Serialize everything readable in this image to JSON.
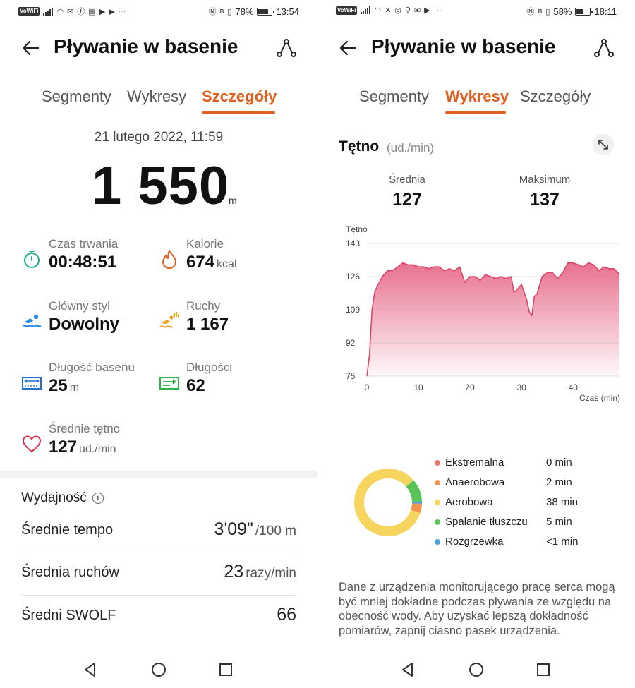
{
  "left": {
    "status": {
      "carrier": "VoWiFi",
      "battery": "78%",
      "battery_level": 0.78,
      "time": "13:54",
      "notif_icons": [
        "signal-icon",
        "wifi-icon",
        "mail-icon",
        "facebook-icon",
        "app-icon",
        "youtube-icon",
        "youtube-icon",
        "more-icon"
      ]
    },
    "header": {
      "title": "Pływanie w basenie"
    },
    "tabs": [
      {
        "label": "Segmenty"
      },
      {
        "label": "Wykresy"
      },
      {
        "label": "Szczegóły",
        "active": true
      }
    ],
    "date": "21 lutego 2022, 11:59",
    "distance": {
      "value": "1 550",
      "unit": "m"
    },
    "stats": [
      {
        "label": "Czas trwania",
        "value": "00:48:51",
        "unit": "",
        "icon": "stopwatch-icon",
        "color": "#1fa98a"
      },
      {
        "label": "Kalorie",
        "value": "674",
        "unit": "kcal",
        "icon": "flame-icon",
        "color": "#e15e21"
      },
      {
        "label": "Główny styl",
        "value": "Dowolny",
        "unit": "",
        "icon": "swimmer-icon",
        "color": "#1e88e5"
      },
      {
        "label": "Ruchy",
        "value": "1 167",
        "unit": "",
        "icon": "stroke-count-icon",
        "color": "#f29d17"
      },
      {
        "label": "Długość basenu",
        "value": "25",
        "unit": "m",
        "icon": "pool-length-icon",
        "color": "#1e6fcf"
      },
      {
        "label": "Długości",
        "value": "62",
        "unit": "",
        "icon": "laps-icon",
        "color": "#2db34a"
      },
      {
        "label": "Średnie tętno",
        "value": "127",
        "unit": "ud./min",
        "icon": "heart-icon",
        "color": "#d6334f"
      }
    ],
    "performance": {
      "title": "Wydajność",
      "rows": [
        {
          "label": "Średnie tempo",
          "value": "3'09\"",
          "unit": "/100 m"
        },
        {
          "label": "Średnia ruchów",
          "value": "23",
          "unit": "razy/min"
        },
        {
          "label": "Średni SWOLF",
          "value": "66",
          "unit": ""
        }
      ]
    }
  },
  "right": {
    "status": {
      "carrier": "VoWiFi",
      "battery": "58%",
      "battery_level": 0.58,
      "time": "18:11",
      "notif_icons": [
        "signal-icon",
        "wifi-icon",
        "x-icon",
        "chrome-icon",
        "location-icon",
        "mail-icon",
        "youtube-icon",
        "more-icon"
      ]
    },
    "header": {
      "title": "Pływanie w basenie"
    },
    "tabs": [
      {
        "label": "Segmenty"
      },
      {
        "label": "Wykresy",
        "active": true
      },
      {
        "label": "Szczegóły"
      }
    ],
    "chart_header": {
      "title": "Tętno",
      "unit": "(ud./min)"
    },
    "hr_avg": {
      "label": "Średnia",
      "value": "127"
    },
    "hr_max": {
      "label": "Maksimum",
      "value": "137"
    },
    "zones": [
      {
        "name": "Ekstremalna",
        "value": "0 min",
        "minutes": 0,
        "color": "#e8766c"
      },
      {
        "name": "Anaerobowa",
        "value": "2 min",
        "minutes": 2,
        "color": "#f0944e"
      },
      {
        "name": "Aerobowa",
        "value": "38 min",
        "minutes": 38,
        "color": "#f5d55e"
      },
      {
        "name": "Spalanie tłuszczu",
        "value": "5 min",
        "minutes": 5,
        "color": "#59c35a"
      },
      {
        "name": "Rozgrzewka",
        "value": "<1 min",
        "minutes": 0.5,
        "color": "#4a9ee0"
      }
    ],
    "note": "Dane z urządzenia monitorującego pracę serca mogą być mniej dokładne podczas pływania ze względu na obecność wody. Aby uzyskać lepszą dokładność pomiarów, zapnij ciasno pasek urządzenia."
  },
  "chart_data": {
    "type": "area",
    "title": "",
    "ylabel": "Tętno",
    "xlabel": "Czas (min)",
    "xlim": [
      0,
      49
    ],
    "ylim": [
      75,
      143
    ],
    "yticks": [
      75,
      92,
      109,
      126,
      143
    ],
    "xticks": [
      0,
      10,
      20,
      30,
      40
    ],
    "grid": true,
    "series": [
      {
        "color": "#e0436a",
        "x": [
          0,
          0.5,
          1,
          1.5,
          2,
          3,
          4,
          5,
          6,
          7,
          8,
          9,
          10,
          11,
          12,
          13,
          14,
          15,
          16,
          17,
          18,
          19,
          20,
          21,
          22,
          23,
          24,
          25,
          26,
          27,
          28,
          28.5,
          29,
          30,
          31,
          31.5,
          32,
          32.5,
          33,
          34,
          35,
          36,
          37,
          38,
          39,
          40,
          41,
          42,
          43,
          44,
          45,
          46,
          47,
          48,
          49
        ],
        "y": [
          75,
          86,
          109,
          118,
          121,
          126,
          129,
          129,
          131,
          133,
          132,
          132,
          131,
          131,
          130,
          131,
          131,
          129,
          130,
          129,
          131,
          123,
          126,
          126,
          124,
          127,
          126,
          125,
          126,
          125,
          126,
          118,
          119,
          122,
          114,
          108,
          106,
          116,
          117,
          126,
          128,
          128,
          125,
          128,
          133,
          133,
          132,
          131,
          133,
          132,
          129,
          131,
          130,
          130,
          127
        ]
      }
    ]
  }
}
